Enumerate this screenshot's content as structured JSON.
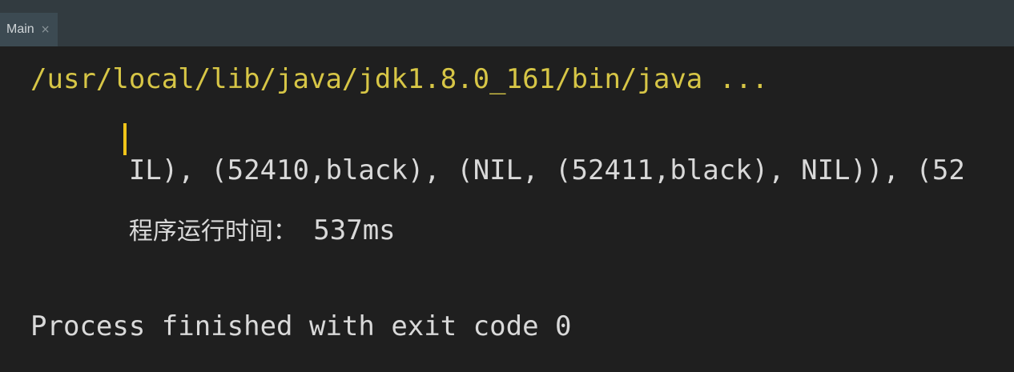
{
  "tab": {
    "label": "Main",
    "close_glyph": "×",
    "close_icon": "close-icon"
  },
  "console": {
    "command_line": "/usr/local/lib/java/jdk1.8.0_161/bin/java ...",
    "output_before_caret": "IL), ",
    "output_after_caret": "(52410,black), (NIL, (52411,black), NIL)), (52",
    "runtime_label": "程序运行时间：",
    "runtime_value": " 537ms",
    "exit_message": "Process finished with exit code 0"
  },
  "colors": {
    "background": "#1f1f1f",
    "tabbar": "#323b40",
    "active_tab": "#3c4a52",
    "command_text": "#d7c646",
    "output_text": "#d9d9d9",
    "caret": "#f0c419"
  }
}
